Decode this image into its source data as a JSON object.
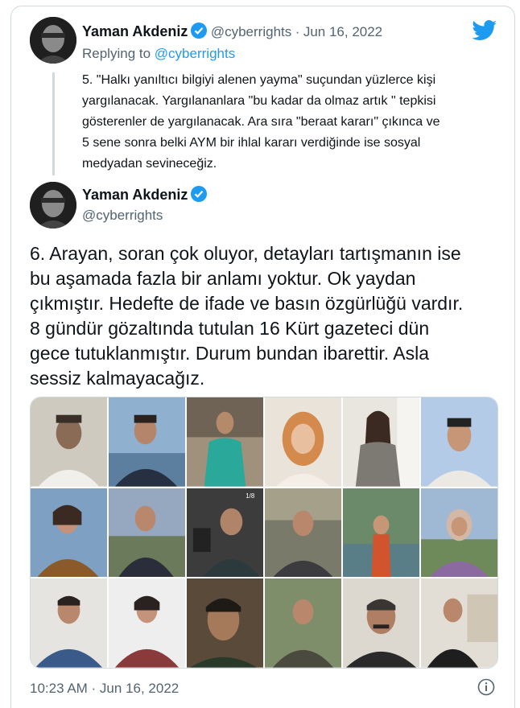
{
  "tweet1": {
    "author_name": "Yaman Akdeniz",
    "handle": "@cyberrights",
    "separator": "·",
    "date": "Jun 16, 2022",
    "replying_prefix": "Replying to",
    "replying_handle": "@cyberrights",
    "text_lines": [
      "5. \"Halkı yanıltıcı bilgiyi alenen yayma\" suçundan yüzlerce kişi",
      "yargılanacak. Yargılananlara \"bu kadar da olmaz artık \" tepkisi",
      "gösterenler de yargılanacak. Ara sıra \"beraat kararı\" çıkınca ve",
      "5 sene sonra belki AYM bir ihlal kararı verdiğinde ise sosyal",
      "medyadan sevineceğiz."
    ]
  },
  "tweet2": {
    "author_name": "Yaman Akdeniz",
    "handle": "@cyberrights",
    "text_lines": [
      "6. Arayan, soran çok oluyor, detayları tartışmanın ise",
      "bu aşamada fazla bir anlamı yoktur. Ok yaydan",
      "çıkmıştır. Hedefte de ifade ve basın özgürlüğü vardır.",
      "8 gündür gözaltında tutulan 16 Kürt gazeteci dün",
      "gece tutuklanmıştır. Durum bundan ibarettir. Asla",
      "sessiz kalmayacağız."
    ],
    "photo_overlay_text": "1/8",
    "timestamp": "10:23 AM · Jun 16, 2022"
  },
  "icons": {
    "brand": "twitter-bird-icon",
    "verified": "verified-badge-icon",
    "info": "info-icon"
  },
  "colors": {
    "accent": "#1d9bf0",
    "muted": "#536471",
    "text": "#0f1419",
    "border": "#cfd9de"
  }
}
